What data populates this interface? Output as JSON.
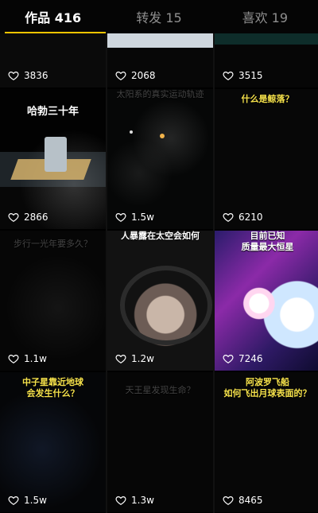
{
  "tabs": [
    {
      "label": "作品 416",
      "active": true
    },
    {
      "label": "转发 15",
      "active": false
    },
    {
      "label": "喜欢 19",
      "active": false
    }
  ],
  "grid": [
    {
      "caption": "",
      "likes": "3836"
    },
    {
      "caption": "",
      "likes": "2068"
    },
    {
      "caption": "",
      "likes": "3515"
    },
    {
      "caption": "哈勃三十年",
      "likes": "2866"
    },
    {
      "caption": "太阳系的真实运动轨迹",
      "likes": "1.5w"
    },
    {
      "caption": "什么是鲸落？",
      "likes": "6210"
    },
    {
      "caption": "步行一光年要多久？",
      "likes": "1.1w"
    },
    {
      "caption": "人暴露在太空会如何",
      "likes": "1.2w"
    },
    {
      "caption": "目前已知\n质量最大恒星",
      "likes": "7246"
    },
    {
      "caption": "中子星靠近地球\n会发生什么？",
      "likes": "1.5w"
    },
    {
      "caption": "天王星发现生命？",
      "likes": "1.3w"
    },
    {
      "caption": "阿波罗飞船\n如何飞出月球表面的？",
      "likes": "8465"
    }
  ],
  "colors": {
    "accent": "#f5c400",
    "yellowCaption": "#f6e24b"
  },
  "icons": {
    "like": "heart-icon"
  }
}
